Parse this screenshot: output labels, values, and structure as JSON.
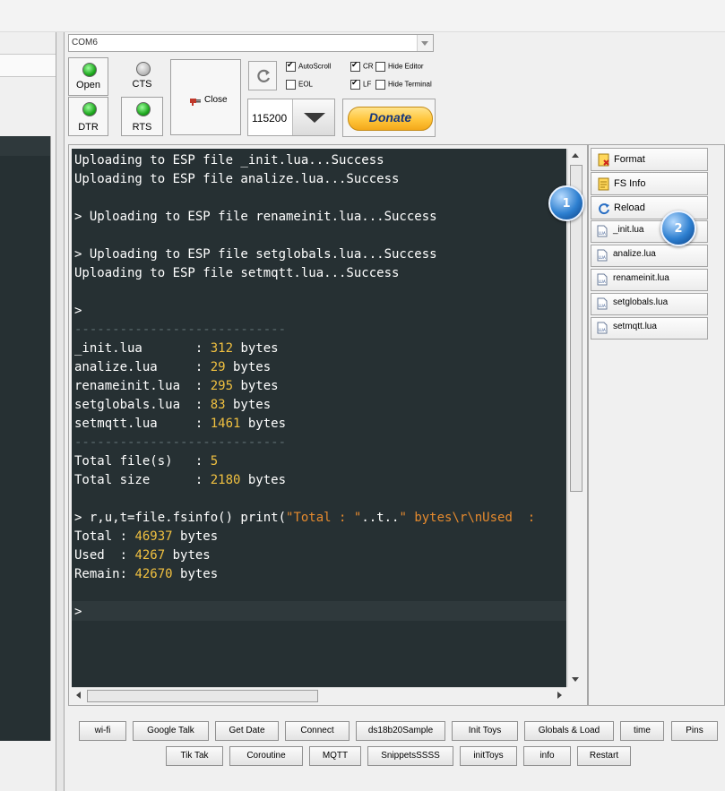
{
  "port": {
    "selected": "COM6"
  },
  "controls": {
    "open_label": "Open",
    "cts_label": "CTS",
    "dtr_label": "DTR",
    "rts_label": "RTS",
    "close_label": "Close",
    "baud": "115200",
    "donate_label": "Donate",
    "checkboxes": {
      "autoscroll": {
        "label": "AutoScroll",
        "checked": true
      },
      "eol": {
        "label": "EOL",
        "checked": false
      },
      "cr": {
        "label": "CR",
        "checked": true
      },
      "lf": {
        "label": "LF",
        "checked": true
      },
      "hide_editor": {
        "label": "Hide Editor",
        "checked": false
      },
      "hide_terminal": {
        "label": "Hide Terminal",
        "checked": false
      }
    }
  },
  "terminal": {
    "l1": "Uploading to ESP file _init.lua...Success",
    "l2": "Uploading to ESP file analize.lua...Success",
    "l3": "> Uploading to ESP file renameinit.lua...Success",
    "l4": "> Uploading to ESP file setglobals.lua...Success",
    "l5": "Uploading to ESP file setmqtt.lua...Success",
    "prompt": ">",
    "dashes": "----------------------------",
    "files": [
      {
        "name": "_init.lua       : ",
        "size": "312",
        "unit": " bytes"
      },
      {
        "name": "analize.lua     : ",
        "size": "29",
        "unit": " bytes"
      },
      {
        "name": "renameinit.lua  : ",
        "size": "295",
        "unit": " bytes"
      },
      {
        "name": "setglobals.lua  : ",
        "size": "83",
        "unit": " bytes"
      },
      {
        "name": "setmqtt.lua     : ",
        "size": "1461",
        "unit": " bytes"
      }
    ],
    "total_files_label": "Total file(s)   : ",
    "total_files": "5",
    "total_size_label": "Total size      : ",
    "total_size": "2180",
    "bytes": " bytes",
    "cmd_code": "> r,u,t=file.fsinfo() print(",
    "cmd_str": "\"Total : \"",
    "cmd_code2": "..t..",
    "cmd_str2": "\" bytes\\r\\nUsed  :",
    "total_label": "Total : ",
    "total_val": "46937",
    "used_label": "Used  : ",
    "used_val": "4267",
    "remain_label": "Remain: ",
    "remain_val": "42670"
  },
  "fs_panel": {
    "format": "Format",
    "fs_info": "FS Info",
    "reload": "Reload",
    "files": [
      "_init.lua",
      "analize.lua",
      "renameinit.lua",
      "setglobals.lua",
      "setmqtt.lua"
    ]
  },
  "callouts": {
    "one": "1",
    "two": "2"
  },
  "snippets": {
    "row1": [
      "wi-fi",
      "Google Talk",
      "Get Date",
      "Connect",
      "ds18b20Sample",
      "Init Toys",
      "Globals & Load",
      "time",
      "Pins"
    ],
    "row2": [
      "Tik Tak",
      "Coroutine",
      "MQTT",
      "SnippetsSSSS",
      "initToys",
      "info",
      "Restart"
    ]
  },
  "colors": {
    "terminal_bg": "#263033",
    "number": "#f0c040",
    "string": "#e58a2e",
    "donate": "#ffc53a",
    "led_on": "#1fa81f"
  }
}
